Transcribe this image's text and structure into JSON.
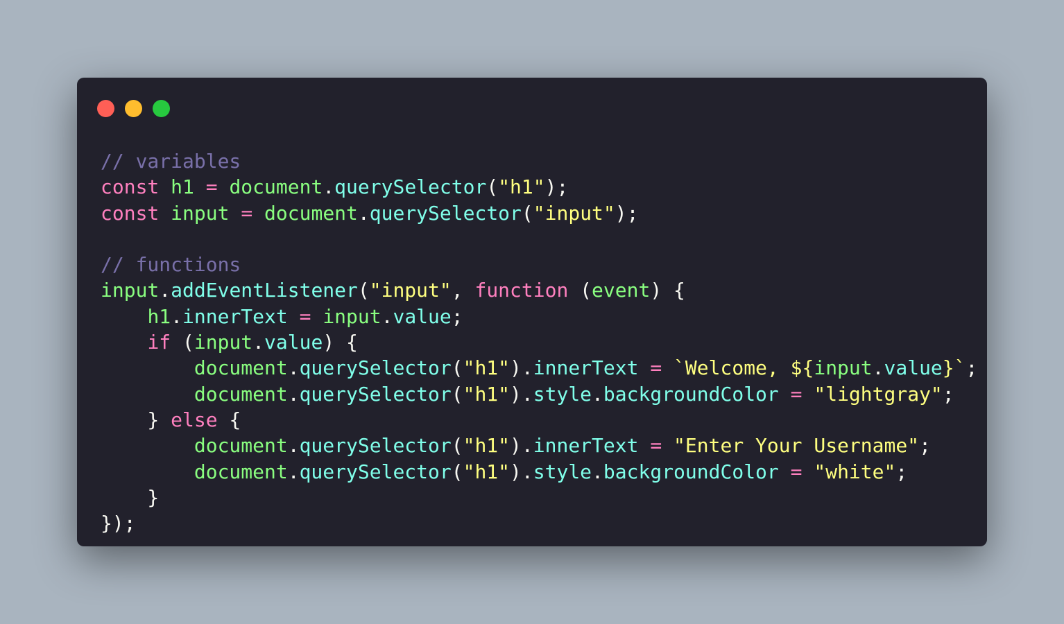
{
  "colors": {
    "background": "#a9b4bf",
    "window": "#22212c",
    "close": "#ff5f56",
    "minimize": "#ffbd2e",
    "maximize": "#27c93f",
    "comment": "#7970a9",
    "keyword": "#ff80bf",
    "variable": "#8aff80",
    "property": "#80ffea",
    "string": "#ffff80",
    "punctuation": "#f8f8f2"
  },
  "code": {
    "lines": [
      [
        [
          "comment",
          "// variables"
        ]
      ],
      [
        [
          "kw",
          "const"
        ],
        [
          "punc",
          " "
        ],
        [
          "var",
          "h1"
        ],
        [
          "punc",
          " "
        ],
        [
          "op",
          "="
        ],
        [
          "punc",
          " "
        ],
        [
          "var",
          "document"
        ],
        [
          "punc",
          "."
        ],
        [
          "prop",
          "querySelector"
        ],
        [
          "punc",
          "("
        ],
        [
          "str",
          "\"h1\""
        ],
        [
          "punc",
          ");"
        ]
      ],
      [
        [
          "kw",
          "const"
        ],
        [
          "punc",
          " "
        ],
        [
          "var",
          "input"
        ],
        [
          "punc",
          " "
        ],
        [
          "op",
          "="
        ],
        [
          "punc",
          " "
        ],
        [
          "var",
          "document"
        ],
        [
          "punc",
          "."
        ],
        [
          "prop",
          "querySelector"
        ],
        [
          "punc",
          "("
        ],
        [
          "str",
          "\"input\""
        ],
        [
          "punc",
          ");"
        ]
      ],
      [],
      [
        [
          "comment",
          "// functions"
        ]
      ],
      [
        [
          "var",
          "input"
        ],
        [
          "punc",
          "."
        ],
        [
          "prop",
          "addEventListener"
        ],
        [
          "punc",
          "("
        ],
        [
          "str",
          "\"input\""
        ],
        [
          "punc",
          ", "
        ],
        [
          "kw",
          "function"
        ],
        [
          "punc",
          " ("
        ],
        [
          "var",
          "event"
        ],
        [
          "punc",
          ") {"
        ]
      ],
      [
        [
          "punc",
          "    "
        ],
        [
          "var",
          "h1"
        ],
        [
          "punc",
          "."
        ],
        [
          "prop",
          "innerText"
        ],
        [
          "punc",
          " "
        ],
        [
          "op",
          "="
        ],
        [
          "punc",
          " "
        ],
        [
          "var",
          "input"
        ],
        [
          "punc",
          "."
        ],
        [
          "prop",
          "value"
        ],
        [
          "punc",
          ";"
        ]
      ],
      [
        [
          "punc",
          "    "
        ],
        [
          "kw",
          "if"
        ],
        [
          "punc",
          " ("
        ],
        [
          "var",
          "input"
        ],
        [
          "punc",
          "."
        ],
        [
          "prop",
          "value"
        ],
        [
          "punc",
          ") {"
        ]
      ],
      [
        [
          "punc",
          "        "
        ],
        [
          "var",
          "document"
        ],
        [
          "punc",
          "."
        ],
        [
          "prop",
          "querySelector"
        ],
        [
          "punc",
          "("
        ],
        [
          "str",
          "\"h1\""
        ],
        [
          "punc",
          ")."
        ],
        [
          "prop",
          "innerText"
        ],
        [
          "punc",
          " "
        ],
        [
          "op",
          "="
        ],
        [
          "punc",
          " "
        ],
        [
          "str",
          "`Welcome, ${"
        ],
        [
          "var",
          "input"
        ],
        [
          "punc",
          "."
        ],
        [
          "prop",
          "value"
        ],
        [
          "str",
          "}`"
        ],
        [
          "punc",
          ";"
        ]
      ],
      [
        [
          "punc",
          "        "
        ],
        [
          "var",
          "document"
        ],
        [
          "punc",
          "."
        ],
        [
          "prop",
          "querySelector"
        ],
        [
          "punc",
          "("
        ],
        [
          "str",
          "\"h1\""
        ],
        [
          "punc",
          ")."
        ],
        [
          "prop",
          "style"
        ],
        [
          "punc",
          "."
        ],
        [
          "prop",
          "backgroundColor"
        ],
        [
          "punc",
          " "
        ],
        [
          "op",
          "="
        ],
        [
          "punc",
          " "
        ],
        [
          "str",
          "\"lightgray\""
        ],
        [
          "punc",
          ";"
        ]
      ],
      [
        [
          "punc",
          "    } "
        ],
        [
          "kw",
          "else"
        ],
        [
          "punc",
          " {"
        ]
      ],
      [
        [
          "punc",
          "        "
        ],
        [
          "var",
          "document"
        ],
        [
          "punc",
          "."
        ],
        [
          "prop",
          "querySelector"
        ],
        [
          "punc",
          "("
        ],
        [
          "str",
          "\"h1\""
        ],
        [
          "punc",
          ")."
        ],
        [
          "prop",
          "innerText"
        ],
        [
          "punc",
          " "
        ],
        [
          "op",
          "="
        ],
        [
          "punc",
          " "
        ],
        [
          "str",
          "\"Enter Your Username\""
        ],
        [
          "punc",
          ";"
        ]
      ],
      [
        [
          "punc",
          "        "
        ],
        [
          "var",
          "document"
        ],
        [
          "punc",
          "."
        ],
        [
          "prop",
          "querySelector"
        ],
        [
          "punc",
          "("
        ],
        [
          "str",
          "\"h1\""
        ],
        [
          "punc",
          ")."
        ],
        [
          "prop",
          "style"
        ],
        [
          "punc",
          "."
        ],
        [
          "prop",
          "backgroundColor"
        ],
        [
          "punc",
          " "
        ],
        [
          "op",
          "="
        ],
        [
          "punc",
          " "
        ],
        [
          "str",
          "\"white\""
        ],
        [
          "punc",
          ";"
        ]
      ],
      [
        [
          "punc",
          "    }"
        ]
      ],
      [
        [
          "punc",
          "});"
        ]
      ]
    ]
  }
}
